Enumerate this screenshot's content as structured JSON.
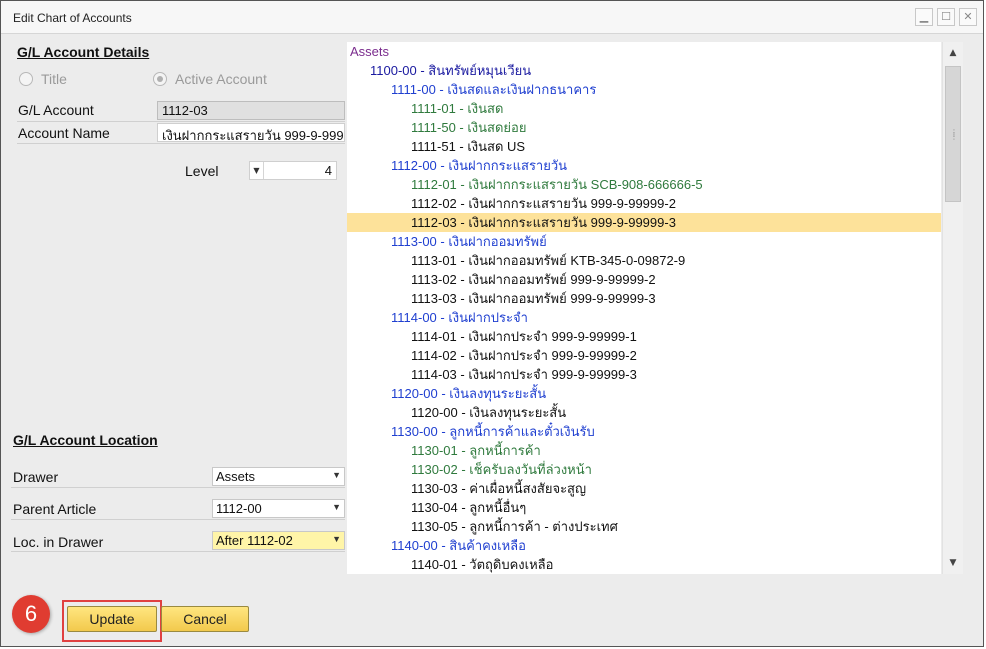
{
  "window": {
    "title": "Edit Chart of Accounts"
  },
  "details": {
    "header": "G/L Account Details",
    "radio_title": "Title",
    "radio_active": "Active Account",
    "gl_account_label": "G/L Account",
    "gl_account_value": "1112-03",
    "account_name_label": "Account Name",
    "account_name_value": "เงินฝากกระแสรายวัน 999-9-999",
    "level_label": "Level",
    "level_value": "4"
  },
  "location": {
    "header": "G/L Account Location",
    "drawer_label": "Drawer",
    "drawer_value": "Assets",
    "parent_label": "Parent Article",
    "parent_value": "1112-00",
    "loc_label": "Loc. in Drawer",
    "loc_value": "After 1112-02"
  },
  "tree": {
    "items": [
      {
        "text": "Assets",
        "level": 0,
        "color": "#7b2d8e"
      },
      {
        "text": "1100-00 - สินทรัพย์หมุนเวียน",
        "level": 1,
        "color": "#1a1aa0"
      },
      {
        "text": "1111-00 - เงินสดและเงินฝากธนาคาร",
        "level": 2,
        "color": "#1f3fd0"
      },
      {
        "text": "1111-01 - เงินสด",
        "level": 3,
        "color": "#2f7a3d"
      },
      {
        "text": "1111-50 - เงินสดย่อย",
        "level": 3,
        "color": "#2f7a3d"
      },
      {
        "text": "1111-51 - เงินสด US",
        "level": 3,
        "color": "#111111"
      },
      {
        "text": "1112-00 - เงินฝากกระแสรายวัน",
        "level": 2,
        "color": "#1f3fd0"
      },
      {
        "text": "1112-01 - เงินฝากกระแสรายวัน SCB-908-666666-5",
        "level": 3,
        "color": "#2f7a3d"
      },
      {
        "text": "1112-02 - เงินฝากกระแสรายวัน 999-9-99999-2",
        "level": 3,
        "color": "#111111"
      },
      {
        "text": "1112-03 - เงินฝากกระแสรายวัน 999-9-99999-3",
        "level": 3,
        "color": "#111111",
        "selected": true
      },
      {
        "text": "1113-00 - เงินฝากออมทรัพย์",
        "level": 2,
        "color": "#1f3fd0"
      },
      {
        "text": "1113-01 - เงินฝากออมทรัพย์ KTB-345-0-09872-9",
        "level": 3,
        "color": "#111111"
      },
      {
        "text": "1113-02 - เงินฝากออมทรัพย์ 999-9-99999-2",
        "level": 3,
        "color": "#111111"
      },
      {
        "text": "1113-03 - เงินฝากออมทรัพย์ 999-9-99999-3",
        "level": 3,
        "color": "#111111"
      },
      {
        "text": "1114-00 - เงินฝากประจำ",
        "level": 2,
        "color": "#1f3fd0"
      },
      {
        "text": "1114-01 - เงินฝากประจำ 999-9-99999-1",
        "level": 3,
        "color": "#111111"
      },
      {
        "text": "1114-02 - เงินฝากประจำ 999-9-99999-2",
        "level": 3,
        "color": "#111111"
      },
      {
        "text": "1114-03 - เงินฝากประจำ 999-9-99999-3",
        "level": 3,
        "color": "#111111"
      },
      {
        "text": "1120-00 - เงินลงทุนระยะสั้น",
        "level": 2,
        "color": "#1f3fd0"
      },
      {
        "text": "1120-00 - เงินลงทุนระยะสั้น",
        "level": 3,
        "color": "#111111"
      },
      {
        "text": "1130-00 - ลูกหนี้การค้าและตั๋วเงินรับ",
        "level": 2,
        "color": "#1f3fd0"
      },
      {
        "text": "1130-01 - ลูกหนี้การค้า",
        "level": 3,
        "color": "#2f7a3d"
      },
      {
        "text": "1130-02 - เช็ครับลงวันที่ล่วงหน้า",
        "level": 3,
        "color": "#2f7a3d"
      },
      {
        "text": "1130-03 - ค่าเผื่อหนี้สงสัยจะสูญ",
        "level": 3,
        "color": "#111111"
      },
      {
        "text": "1130-04 - ลูกหนี้อื่นๆ",
        "level": 3,
        "color": "#111111"
      },
      {
        "text": "1130-05 - ลูกหนี้การค้า - ต่างประเทศ",
        "level": 3,
        "color": "#111111"
      },
      {
        "text": "1140-00 - สินค้าคงเหลือ",
        "level": 2,
        "color": "#1f3fd0"
      },
      {
        "text": "1140-01 - วัตถุดิบคงเหลือ",
        "level": 3,
        "color": "#111111"
      }
    ]
  },
  "buttons": {
    "update": "Update",
    "cancel": "Cancel"
  },
  "annotation": {
    "step": "6"
  },
  "colors": {
    "selected_row": "#fde29a",
    "button_yellow": "#f2c94c",
    "badge_red": "#e03c31"
  }
}
